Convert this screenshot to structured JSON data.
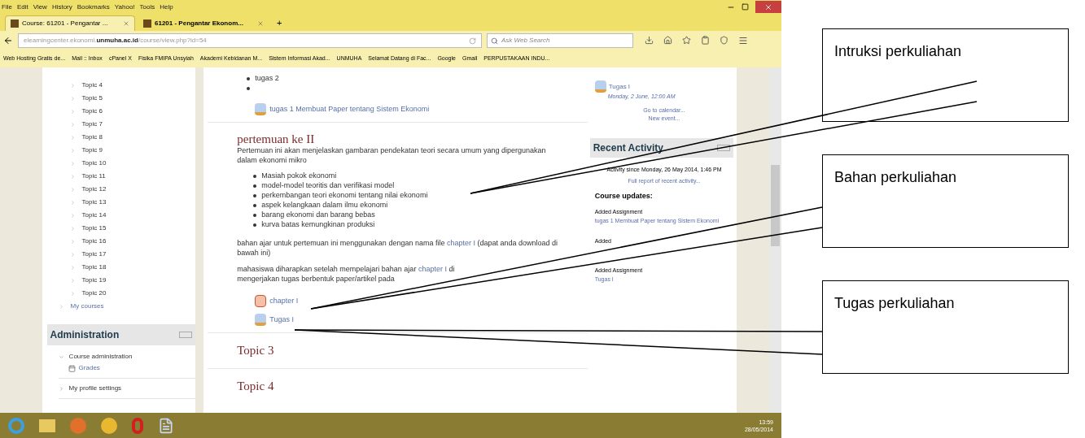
{
  "menu": [
    "File",
    "Edit",
    "View",
    "History",
    "Bookmarks",
    "Yahoo!",
    "Tools",
    "Help"
  ],
  "tabs": [
    {
      "label": "Course: 61201 - Pengantar ...",
      "selected": true
    },
    {
      "label": "61201 - Pengantar Ekonom...",
      "selected": false
    }
  ],
  "new_tab": "+",
  "address": {
    "plain": "elearningcenter.ekonomi.",
    "domain": "unmuha.ac.id",
    "path": "/course/view.php?id=54"
  },
  "search": {
    "placeholder": "Ask Web Search"
  },
  "bookmarks": [
    "Web Hosting Gratis de...",
    "Mail :: Inbox",
    "cPanel X",
    "Fisika FMIPA Unsyiah",
    "Akademi Kebidanan M...",
    "Sistem Informasi Akad...",
    "UNMUHA",
    "Selamat Datang di Fac...",
    "Google",
    "Gmail",
    "PERPUSTAKAAN INDU..."
  ],
  "sidebar": {
    "topics": [
      "Topic 4",
      "Topic 5",
      "Topic 6",
      "Topic 7",
      "Topic 8",
      "Topic 9",
      "Topic 10",
      "Topic 11",
      "Topic 12",
      "Topic 13",
      "Topic 14",
      "Topic 15",
      "Topic 16",
      "Topic 17",
      "Topic 18",
      "Topic 19",
      "Topic 20"
    ],
    "my_courses": "My courses",
    "administration": {
      "title": "Administration",
      "items": [
        {
          "label": "Course administration",
          "expanded": true,
          "children": [
            {
              "label": "Grades"
            }
          ]
        },
        {
          "label": "My profile settings",
          "expanded": false
        }
      ]
    }
  },
  "main": {
    "prev_items": [
      "tugas 2"
    ],
    "trailing_empty_bullet": true,
    "prev_link": "tugas 1 Membuat Paper tentang Sistem Ekonomi",
    "section": {
      "title": "pertemuan ke II",
      "intro": "Pertemuan ini akan menjelaskan gambaran pendekatan teori secara umum yang dipergunakan dalam ekonomi mikro",
      "list": [
        "Masiah pokok ekonomi",
        "model-model teoritis dan verifikasi model",
        "perkembangan teori ekonomi tentang nilai ekonomi",
        "aspek kelangkaan dalam ilmu ekonomi",
        "barang ekonomi dan barang bebas",
        "kurva batas kemungkinan produksi"
      ],
      "para1": {
        "before": "bahan ajar untuk pertemuan ini menggunakan dengan nama file",
        "link": "chapter I",
        "after": "(dapat anda download di bawah ini)"
      },
      "para2": {
        "before": "mahasiswa diharapkan setelah mempelajari bahan ajar",
        "link": "chapter I",
        "after": "di",
        "line2": "mengerjakan tugas berbentuk paper/artikel pada"
      },
      "resources": [
        {
          "kind": "file",
          "label": "chapter I"
        },
        {
          "kind": "assignment",
          "label": "Tugas I"
        }
      ]
    },
    "topics": [
      "Topic 3",
      "Topic 4"
    ]
  },
  "right": {
    "event": {
      "title": "Tugas I",
      "date": "Monday, 2 June, 12:00 AM"
    },
    "links": [
      "Go to calendar...",
      "New event..."
    ],
    "recent": {
      "title": "Recent Activity",
      "since": "Activity since Monday, 26 May 2014, 1:46 PM",
      "report": "Full report of recent activity...",
      "updates_title": "Course updates:",
      "updates": [
        {
          "label": "Added Assignment",
          "link": "tugas 1 Membuat Paper tentang Sistem Ekonomi"
        },
        {
          "label": "Added"
        },
        {
          "label": "Added Assignment",
          "link": "Tugas I"
        }
      ]
    }
  },
  "taskbar": {
    "time": "13:59",
    "date": "28/05/2014"
  },
  "annotations": [
    "Intruksi perkuliahan",
    "Bahan perkuliahan",
    "Tugas perkuliahan"
  ]
}
